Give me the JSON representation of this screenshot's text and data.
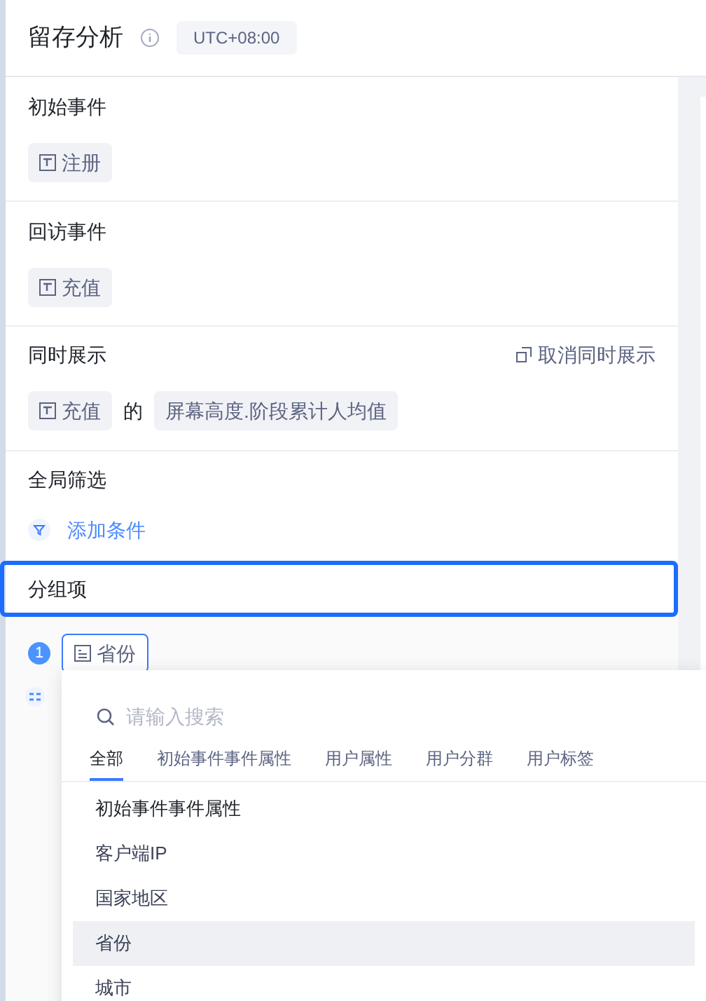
{
  "header": {
    "title": "留存分析",
    "timezone": "UTC+08:00"
  },
  "initial_event": {
    "label": "初始事件",
    "event": "注册"
  },
  "return_event": {
    "label": "回访事件",
    "event": "充值"
  },
  "show_also": {
    "label": "同时展示",
    "cancel": "取消同时展示",
    "event": "充值",
    "joiner": "的",
    "metric": "屏幕高度.阶段累计人均值"
  },
  "global_filter": {
    "label": "全局筛选",
    "add": "添加条件"
  },
  "group_by": {
    "label": "分组项",
    "items": [
      {
        "index": "1",
        "name": "省份"
      }
    ]
  },
  "dropdown": {
    "search": {
      "placeholder": "请输入搜索"
    },
    "tabs": [
      {
        "label": "全部",
        "selected": true
      },
      {
        "label": "初始事件事件属性",
        "selected": false
      },
      {
        "label": "用户属性",
        "selected": false
      },
      {
        "label": "用户分群",
        "selected": false
      },
      {
        "label": "用户标签",
        "selected": false
      }
    ],
    "options": [
      {
        "label": "初始事件事件属性",
        "kind": "heading",
        "selected": false
      },
      {
        "label": "客户端IP",
        "kind": "option",
        "selected": false
      },
      {
        "label": "国家地区",
        "kind": "option",
        "selected": false
      },
      {
        "label": "省份",
        "kind": "option",
        "selected": true
      },
      {
        "label": "城市",
        "kind": "option",
        "selected": false
      }
    ]
  }
}
